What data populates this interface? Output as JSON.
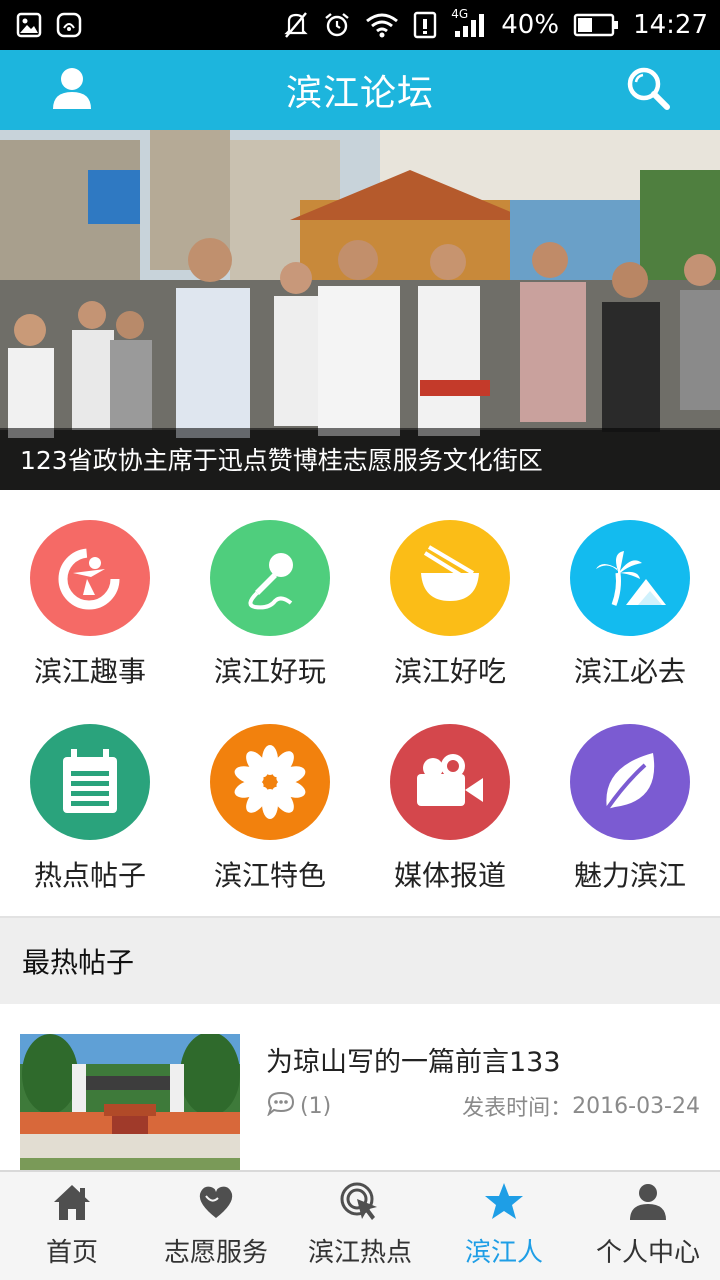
{
  "status_bar": {
    "battery": "40%",
    "time": "14:27",
    "network": "4G"
  },
  "app_bar": {
    "title": "滨江论坛",
    "icons": [
      "user-icon",
      "search-icon"
    ]
  },
  "banner": {
    "caption": "123省政协主席于迅点赞博桂志愿服务文化街区"
  },
  "grid": {
    "items": [
      {
        "label": "滨江趣事",
        "icon": "logo-icon",
        "color": "#f56a66"
      },
      {
        "label": "滨江好玩",
        "icon": "microphone-icon",
        "color": "#4fce7d"
      },
      {
        "label": "滨江好吃",
        "icon": "noodle-bowl-icon",
        "color": "#fbbd17"
      },
      {
        "label": "滨江必去",
        "icon": "palm-tree-icon",
        "color": "#13bbef"
      },
      {
        "label": "热点帖子",
        "icon": "calendar-icon",
        "color": "#2aa37c"
      },
      {
        "label": "滨江特色",
        "icon": "flower-icon",
        "color": "#f2810d"
      },
      {
        "label": "媒体报道",
        "icon": "video-camera-icon",
        "color": "#d4474c"
      },
      {
        "label": "魅力滨江",
        "icon": "leaf-icon",
        "color": "#7b5bd2"
      }
    ]
  },
  "section": {
    "title": "最热帖子"
  },
  "posts": [
    {
      "title": "为琼山写的一篇前言133",
      "comment_count": "(1)",
      "date_label": "发表时间：",
      "date": "2016-03-24"
    }
  ],
  "bottom_nav": {
    "items": [
      {
        "label": "首页",
        "icon": "home-icon"
      },
      {
        "label": "志愿服务",
        "icon": "heart-icon"
      },
      {
        "label": "滨江热点",
        "icon": "cursor-click-icon"
      },
      {
        "label": "滨江人",
        "icon": "star-icon",
        "active": true
      },
      {
        "label": "个人中心",
        "icon": "person-icon"
      }
    ]
  },
  "colors": {
    "primary": "#1db5dd",
    "nav_active": "#1e9ee6"
  }
}
